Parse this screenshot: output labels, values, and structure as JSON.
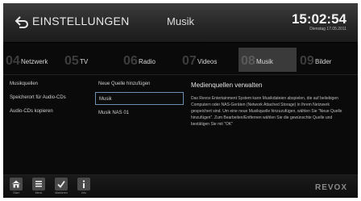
{
  "header": {
    "title": "EINSTELLUNGEN",
    "section": "Musik",
    "time": "15:02:54",
    "date": "Dienstag 17.05.2011",
    "back_icon": "back-arrow-icon"
  },
  "tabs": [
    {
      "num": "04",
      "label": "Netzwerk"
    },
    {
      "num": "05",
      "label": "TV"
    },
    {
      "num": "06",
      "label": "Radio"
    },
    {
      "num": "07",
      "label": "Videos"
    },
    {
      "num": "08",
      "label": "Musik",
      "active": true
    },
    {
      "num": "09",
      "label": "Bilder"
    }
  ],
  "left_menu": [
    "Musikquellen",
    "Speicherort für Audio-CDs",
    "Audio-CDs kopieren"
  ],
  "sources": [
    "Neue Quelle hinzufügen",
    "Musik",
    "Musik NAS 01"
  ],
  "selected_source_index": 1,
  "description": {
    "title": "Medienquellen verwalten",
    "text": "Das Revox Entertainment System kann Musikdateien abspielen, die auf beliebigen Computern oder NAS-Geräten (Network Attached Storage) in Ihrem Netzwerk gespeichert sind. Um eine neue Musikquelle hinzuzufügen, wählen Sie \"Neue Quelle hinzufügen\". Zum Bearbeiten/Entfernen wählen Sie die gewünschte Quelle und bestätigen Sie mit \"OK\""
  },
  "footer": {
    "buttons": [
      {
        "icon": "home-icon",
        "label": "Start"
      },
      {
        "icon": "menu-icon",
        "label": "Menü"
      },
      {
        "icon": "checkmark-icon",
        "label": "Markieren"
      },
      {
        "icon": "info-icon",
        "label": "Info"
      }
    ],
    "logo": "REVOX"
  }
}
